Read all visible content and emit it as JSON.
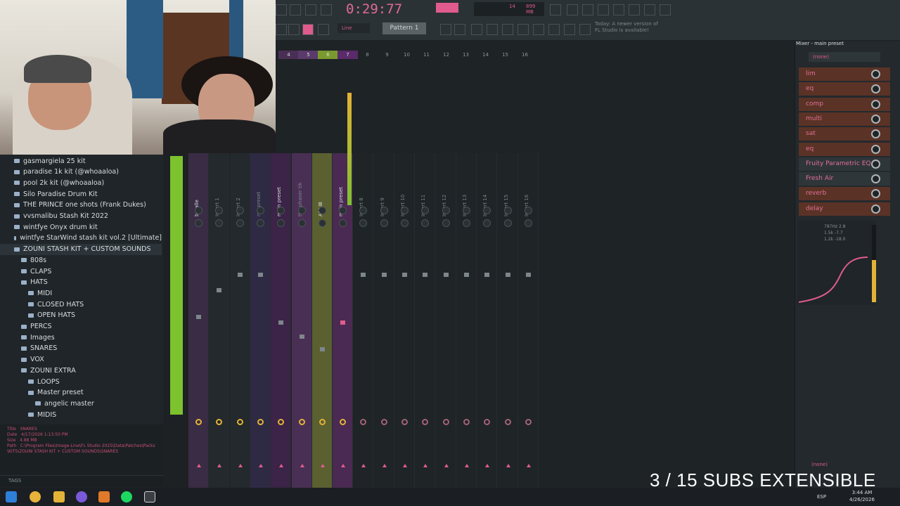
{
  "toolbar": {
    "time": "0:29:77",
    "pattern": "Pattern 1",
    "snap": "Line",
    "news": "Today: A newer version of FL Studio is available!",
    "memory": "899 MB",
    "cpu": "14"
  },
  "browser": {
    "items": [
      {
        "label": "gasmargiela 25 kit",
        "indent": 1
      },
      {
        "label": "paradise 1k kit (@whoaaloa)",
        "indent": 1
      },
      {
        "label": "pool 2k kit (@whoaaloa)",
        "indent": 1
      },
      {
        "label": "Silo Paradise Drum Kit",
        "indent": 1
      },
      {
        "label": "THE PRINCE one shots (Frank Dukes)",
        "indent": 1
      },
      {
        "label": "vvsmalibu Stash Kit 2022",
        "indent": 1
      },
      {
        "label": "wintfye Onyx drum kit",
        "indent": 1
      },
      {
        "label": "wintfye StarWind stash kit vol.2 [Ultimate]",
        "indent": 1
      },
      {
        "label": "ZOUNI STASH KIT + CUSTOM SOUNDS",
        "indent": 1
      },
      {
        "label": "808s",
        "indent": 2
      },
      {
        "label": "CLAPS",
        "indent": 2
      },
      {
        "label": "HATS",
        "indent": 2
      },
      {
        "label": "MIDI",
        "indent": 3
      },
      {
        "label": "CLOSED HATS",
        "indent": 3
      },
      {
        "label": "OPEN HATS",
        "indent": 3
      },
      {
        "label": "PERCS",
        "indent": 2
      },
      {
        "label": "Images",
        "indent": 2
      },
      {
        "label": "SNARES",
        "indent": 2
      },
      {
        "label": "VOX",
        "indent": 2
      },
      {
        "label": "ZOUNI EXTRA",
        "indent": 2
      },
      {
        "label": "LOOPS",
        "indent": 3
      },
      {
        "label": "Master preset",
        "indent": 3
      },
      {
        "label": "angelic master",
        "indent": 4
      },
      {
        "label": "MIDIS",
        "indent": 3
      }
    ],
    "info": {
      "title_label": "Title",
      "title": "SNARES",
      "date_label": "Date",
      "date": "4/17/2026 1:13:50 PM",
      "size_label": "Size",
      "size": "4.88 MB",
      "path_label": "Path",
      "path": "C:\\Program Files\\Image-Line\\FL Studio 2025\\Data\\Patches\\Packs\\KITS\\ZOUNI STASH KIT + CUSTOM SOUNDS\\SNARES"
    },
    "tags_label": "TAGS"
  },
  "mixer": {
    "strips": [
      {
        "name": "bryalle"
      },
      {
        "name": "Insert 1"
      },
      {
        "name": "Insert 2"
      },
      {
        "name": "rec preset"
      },
      {
        "name": "main preset"
      },
      {
        "name": "the phaser tik"
      },
      {
        "name": "ADLIB"
      },
      {
        "name": "main preset"
      },
      {
        "name": "Insert 8"
      },
      {
        "name": "Insert 9"
      },
      {
        "name": "Insert 10"
      },
      {
        "name": "Insert 11"
      },
      {
        "name": "Insert 12"
      },
      {
        "name": "Insert 13"
      },
      {
        "name": "Insert 14"
      },
      {
        "name": "Insert 15"
      },
      {
        "name": "Insert 16"
      }
    ],
    "numbers": [
      "4",
      "5",
      "6",
      "7",
      "8",
      "9",
      "10",
      "11",
      "12",
      "13",
      "14",
      "15",
      "16"
    ]
  },
  "mixer_panel": {
    "title": "Mixer - main preset",
    "preset": "(none)",
    "slots": [
      "lim",
      "eq",
      "comp",
      "multi",
      "sat",
      "eq",
      "Fruity Parametric EQ 2",
      "Fresh Air",
      "reverb",
      "delay"
    ],
    "eq_readout": "787Hz 2.8\n1.5k -7.7\n1.2k -18.0",
    "bottom_preset": "(none)"
  },
  "overlay": {
    "subs": "3 / 15 SUBS EXTENSIBLE"
  },
  "taskbar": {
    "lang": "ESP",
    "time": "3:44 AM",
    "date": "4/26/2026"
  }
}
